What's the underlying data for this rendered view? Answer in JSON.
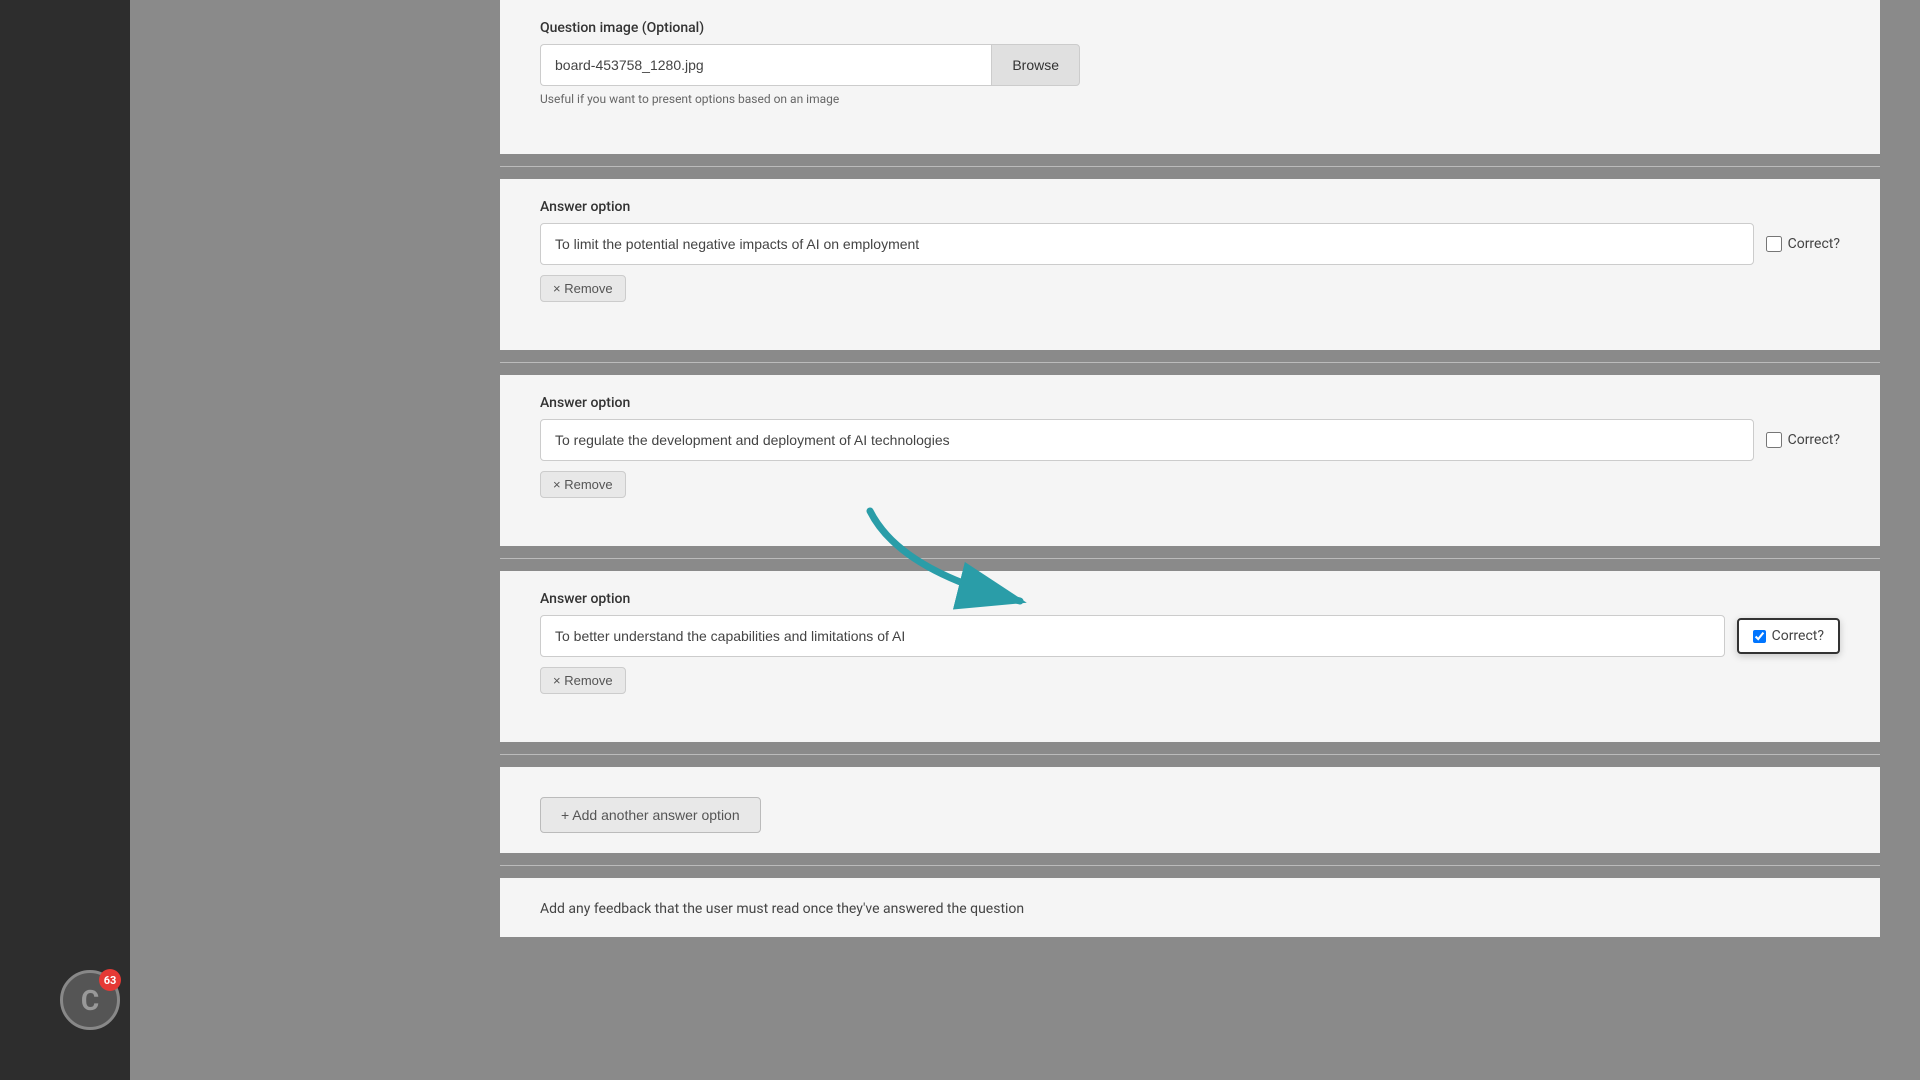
{
  "sidebar": {
    "background": "#2d2d2d"
  },
  "page": {
    "question_image_label": "Question image (Optional)",
    "question_image_value": "board-453758_1280.jpg",
    "browse_button": "Browse",
    "image_helper_text": "Useful if you want to present options based on an image",
    "answer_option_label": "Answer option",
    "correct_label": "Correct?",
    "remove_label": "× Remove",
    "add_answer_label": "+ Add another answer option",
    "feedback_text": "Add any feedback that the user must read once they've answered the question",
    "answers": [
      {
        "id": 1,
        "value": "To limit the potential negative impacts of AI on employment",
        "correct": false
      },
      {
        "id": 2,
        "value": "To regulate the development and deployment of AI technologies",
        "correct": false
      },
      {
        "id": 3,
        "value": "To better understand the capabilities and limitations of AI",
        "correct": true
      }
    ]
  },
  "notification": {
    "count": "63",
    "letter": "C"
  },
  "colors": {
    "teal": "#2a9da8",
    "accent": "#4a9da8"
  }
}
